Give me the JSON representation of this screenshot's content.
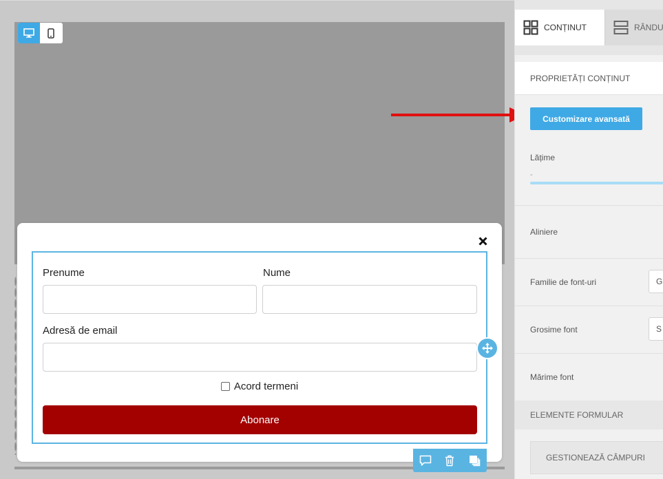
{
  "canvas": {
    "device_toggle": {
      "desktop_icon": "desktop-icon",
      "mobile_icon": "mobile-icon"
    },
    "popup": {
      "close_icon": "close-icon",
      "form": {
        "first_name_label": "Prenume",
        "last_name_label": "Nume",
        "email_label": "Adresă de email",
        "terms_label": "Acord termeni",
        "submit_label": "Abonare"
      }
    },
    "tools": [
      "comment-icon",
      "trash-icon",
      "duplicate-icon"
    ],
    "move_icon": "move-icon"
  },
  "panel": {
    "tabs": [
      {
        "label": "CONȚINUT",
        "icon": "grid-icon"
      },
      {
        "label": "RÂNDURI",
        "icon": "rows-icon"
      }
    ],
    "subtab_label": "PROPRIETĂȚI CONȚINUT",
    "advanced_button": "Customizare avansată",
    "width_label": "Lățime",
    "width_value": "-",
    "align_label": "Aliniere",
    "font_family_label": "Familie de font-uri",
    "font_family_value": "G",
    "font_weight_label": "Grosime font",
    "font_weight_value": "S",
    "font_size_label": "Mărime font",
    "form_elements_header": "ELEMENTE FORMULAR",
    "manage_fields_button": "GESTIONEAZĂ CÂMPURI"
  },
  "colors": {
    "accent": "#3fa9e5",
    "submit": "#a30000",
    "arrow": "#e01010"
  }
}
